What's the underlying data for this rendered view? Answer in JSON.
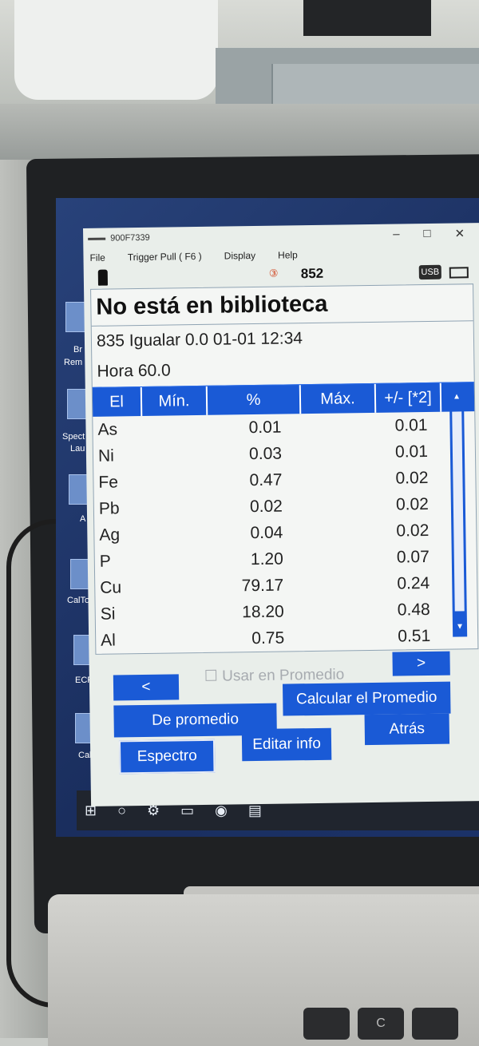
{
  "window": {
    "title": "900F7339",
    "menu": [
      "File",
      "Trigger Pull ( F6 )",
      "Display",
      "Help"
    ],
    "minimize": "–",
    "maximize": "□",
    "close": "✕"
  },
  "status": {
    "pulse_icon": "③",
    "count": "852",
    "usb_label": "USB"
  },
  "result": {
    "heading": "No está en biblioteca",
    "line1": "835  Igualar   0.0 01-01 12:34",
    "line2": "Hora 60.0"
  },
  "table": {
    "headers": [
      "El",
      "Mín.",
      "%",
      "Máx.",
      "+/- [*2]"
    ],
    "rows": [
      {
        "el": "As",
        "pct": "0.01",
        "err": "0.01"
      },
      {
        "el": "Ni",
        "pct": "0.03",
        "err": "0.01"
      },
      {
        "el": "Fe",
        "pct": "0.47",
        "err": "0.02"
      },
      {
        "el": "Pb",
        "pct": "0.02",
        "err": "0.02"
      },
      {
        "el": "Ag",
        "pct": "0.04",
        "err": "0.02"
      },
      {
        "el": "P",
        "pct": "1.20",
        "err": "0.07"
      },
      {
        "el": "Cu",
        "pct": "79.17",
        "err": "0.24"
      },
      {
        "el": "Si",
        "pct": "18.20",
        "err": "0.48"
      },
      {
        "el": "Al",
        "pct": "0.75",
        "err": "0.51"
      }
    ]
  },
  "controls": {
    "prev": "<",
    "next": ">",
    "use_in_average": "Usar en Promedio",
    "from_average": "De promedio",
    "calculate_average": "Calcular el Promedio",
    "spectrum": "Espectro",
    "edit_info": "Editar info",
    "back": "Atrás"
  },
  "desktop": {
    "labels": [
      "Br",
      "Rem",
      "Spect",
      "Lau",
      "A",
      "CalTo",
      "ECR",
      "Cab"
    ]
  },
  "keyboard": {
    "key_c": "C"
  },
  "colors": {
    "accent": "#1a5ad6",
    "window_bg": "#e9eeea",
    "desktop": "#1f3566"
  }
}
